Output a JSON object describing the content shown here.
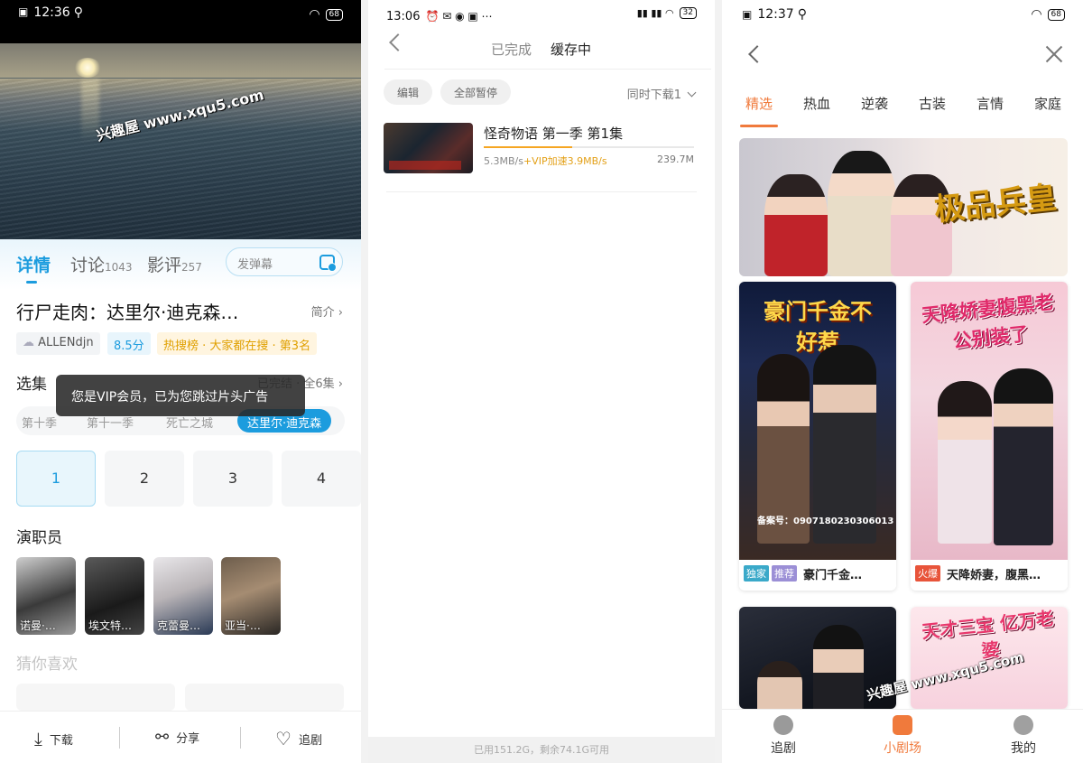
{
  "left": {
    "status": {
      "time": "12:36",
      "battery": "68"
    },
    "watermark": "兴趣屋 www.xqu5.com",
    "tabs": [
      {
        "label": "详情",
        "count": ""
      },
      {
        "label": "讨论",
        "count": "1043"
      },
      {
        "label": "影评",
        "count": "257"
      }
    ],
    "danmu_placeholder": "发弹幕",
    "title": "行尸走肉：达里尔·迪克森…",
    "intro_label": "简介",
    "chips": {
      "user": "ALLENdjn",
      "score": "8.5分",
      "hot": "热搜榜 · 大家都在搜 · 第3名"
    },
    "episodes_label": "选集",
    "episodes_status": "已完结 · 全6集",
    "toast": "您是VIP会员，已为您跳过片头广告",
    "seasons": [
      "第十季",
      "第十一季",
      "死亡之城",
      "达里尔·迪克森"
    ],
    "episodes": [
      "1",
      "2",
      "3",
      "4"
    ],
    "cast_label": "演职员",
    "cast": [
      "诺曼·…",
      "埃文特…",
      "克蕾曼…",
      "亚当·…"
    ],
    "guess_label": "猜你喜欢",
    "bottom": {
      "download": "下载",
      "share": "分享",
      "follow": "追剧"
    }
  },
  "middle": {
    "status": {
      "time": "13:06",
      "battery": "32"
    },
    "segments": [
      "已完成",
      "缓存中"
    ],
    "edit_label": "编辑",
    "pause_all_label": "全部暂停",
    "simultaneous": "同时下载1",
    "item": {
      "title": "怪奇物语 第一季 第1集",
      "speed": "5.3MB/s",
      "vip_speed": "+VIP加速3.9MB/s",
      "size": "239.7M",
      "progress": 0.42
    },
    "storage": "已用151.2G，剩余74.1G可用"
  },
  "right": {
    "status": {
      "time": "12:37",
      "battery": "68"
    },
    "categories": [
      "精选",
      "热血",
      "逆袭",
      "古装",
      "言情",
      "家庭"
    ],
    "banner_title": "极品兵皇",
    "cards": [
      {
        "title": "豪门千金不好惹",
        "tags": [
          "独家",
          "推荐"
        ],
        "caption": "豪门千金…",
        "reg": "备案号：0907180230306013"
      },
      {
        "title": "天降娇妻腹黑老公别装了",
        "tags": [
          "火爆"
        ],
        "caption": "天降娇妻，腹黑…"
      },
      {
        "title": ""
      },
      {
        "title": "天才三宝 亿万老婆"
      }
    ],
    "watermark": "兴趣屋 www.xqu5.com",
    "nav": [
      "追剧",
      "小剧场",
      "我的"
    ],
    "colors": {
      "accent": "#f07a3c",
      "blue": "#1c9cde"
    }
  }
}
